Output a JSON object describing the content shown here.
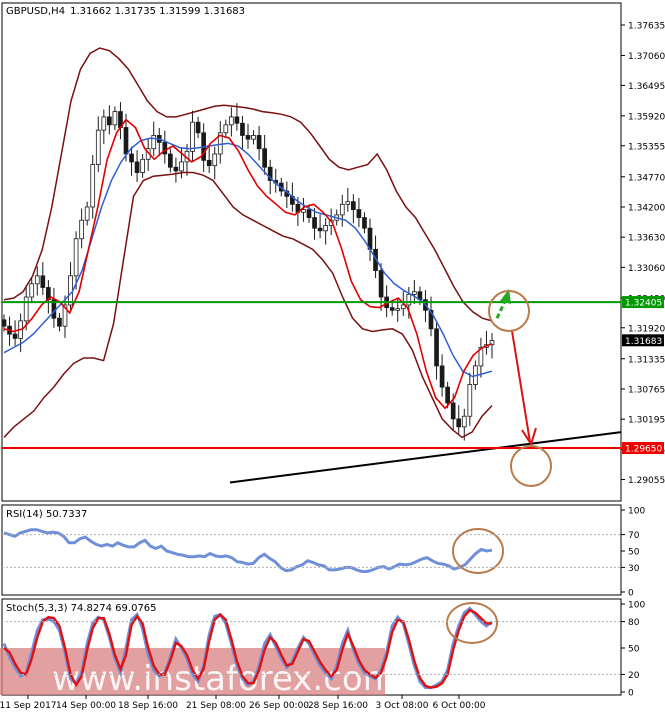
{
  "header": {
    "symbol": "GBPUSD,H4",
    "ohlc": "1.31662 1.31735 1.31599 1.31683"
  },
  "watermark": {
    "text": "www.instaforex.com"
  },
  "colors": {
    "bollinger": "#7a1010",
    "ma_fast": "#e00000",
    "ma_slow": "#2f5fd0",
    "resistance": "#009900",
    "support": "#ee0000",
    "trendline": "#000000",
    "circle": "#b87b4b",
    "arrow_up": "#22aa22",
    "arrow_down": "#dd1111",
    "candle": "#1a1a1a",
    "rsi": "#6f8fd8",
    "stoch_main": "#6f8fd8",
    "stoch_signal": "#e01010",
    "watermark_bg": "#d98080"
  },
  "chart_data": [
    {
      "type": "candlestick",
      "name_label": "GBPUSD,H4",
      "ylim": [
        1.2865,
        1.3805
      ],
      "yticks": [
        "1.37635",
        "1.37060",
        "1.36495",
        "1.35920",
        "1.35355",
        "1.34770",
        "1.34200",
        "1.33630",
        "1.33060",
        "1.32480",
        "1.31920",
        "1.31335",
        "1.30765",
        "1.30195",
        "1.29625",
        "1.29055"
      ],
      "xticks": [
        "11 Sep 2017",
        "14 Sep 00:00",
        "18 Sep 16:00",
        "21 Sep 08:00",
        "26 Sep 00:00",
        "28 Sep 16:00",
        "3 Oct 08:00",
        "6 Oct 00:00"
      ],
      "levels": [
        {
          "name": "resistance",
          "value": 1.32405,
          "label": "1.32405"
        },
        {
          "name": "support",
          "value": 1.2965,
          "label": "1.29650"
        },
        {
          "name": "current",
          "value": 1.31683,
          "label": "1.31683"
        }
      ],
      "close": [
        1.3195,
        1.318,
        1.3172,
        1.3205,
        1.325,
        1.3275,
        1.329,
        1.3268,
        1.3245,
        1.321,
        1.3195,
        1.3235,
        1.329,
        1.336,
        1.3395,
        1.342,
        1.35,
        1.3565,
        1.359,
        1.3575,
        1.36,
        1.357,
        1.352,
        1.3505,
        1.3485,
        1.351,
        1.353,
        1.3555,
        1.3542,
        1.352,
        1.3495,
        1.3488,
        1.3505,
        1.3525,
        1.358,
        1.356,
        1.3508,
        1.3498,
        1.352,
        1.356,
        1.3575,
        1.359,
        1.3578,
        1.3555,
        1.3548,
        1.3555,
        1.353,
        1.3495,
        1.347,
        1.3465,
        1.345,
        1.344,
        1.3425,
        1.341,
        1.3415,
        1.34,
        1.338,
        1.3375,
        1.3385,
        1.3395,
        1.3405,
        1.3425,
        1.343,
        1.3415,
        1.34,
        1.338,
        1.334,
        1.33,
        1.325,
        1.323,
        1.3225,
        1.3228,
        1.3235,
        1.3255,
        1.326,
        1.3245,
        1.3225,
        1.319,
        1.312,
        1.308,
        1.305,
        1.302,
        1.3005,
        1.3025,
        1.3085,
        1.312,
        1.3155,
        1.316,
        1.3168
      ],
      "bb_upper": [
        1.3245,
        1.3248,
        1.326,
        1.329,
        1.334,
        1.342,
        1.352,
        1.362,
        1.368,
        1.371,
        1.372,
        1.3715,
        1.37,
        1.368,
        1.365,
        1.362,
        1.36,
        1.359,
        1.359,
        1.3595,
        1.36,
        1.3605,
        1.361,
        1.3612,
        1.361,
        1.3608,
        1.3605,
        1.36,
        1.3598,
        1.3595,
        1.359,
        1.358,
        1.356,
        1.3535,
        1.351,
        1.3495,
        1.349,
        1.3495,
        1.35,
        1.352,
        1.349,
        1.345,
        1.342,
        1.34,
        1.337,
        1.334,
        1.3305,
        1.327,
        1.324,
        1.3222,
        1.321,
        1.3205
      ],
      "bb_lower": [
        1.2985,
        1.3005,
        1.302,
        1.3035,
        1.306,
        1.308,
        1.3105,
        1.3125,
        1.3135,
        1.3135,
        1.313,
        1.32,
        1.332,
        1.344,
        1.347,
        1.3478,
        1.348,
        1.3482,
        1.3485,
        1.3485,
        1.348,
        1.347,
        1.3445,
        1.342,
        1.3405,
        1.3395,
        1.3385,
        1.3375,
        1.3365,
        1.336,
        1.335,
        1.334,
        1.332,
        1.3295,
        1.325,
        1.321,
        1.319,
        1.3185,
        1.3188,
        1.319,
        1.318,
        1.315,
        1.31,
        1.306,
        1.302,
        1.3,
        1.2985,
        1.2995,
        1.3025,
        1.3045
      ],
      "ma_slow": [
        1.3145,
        1.3155,
        1.3165,
        1.318,
        1.32,
        1.322,
        1.324,
        1.326,
        1.33,
        1.336,
        1.342,
        1.347,
        1.3505,
        1.353,
        1.3545,
        1.355,
        1.3548,
        1.354,
        1.3532,
        1.353,
        1.3532,
        1.3535,
        1.3538,
        1.354,
        1.3535,
        1.352,
        1.35,
        1.348,
        1.3462,
        1.3448,
        1.3432,
        1.342,
        1.341,
        1.3405,
        1.34,
        1.3395,
        1.338,
        1.3355,
        1.3325,
        1.3295,
        1.3275,
        1.3262,
        1.3252,
        1.324,
        1.3215,
        1.318,
        1.314,
        1.311,
        1.31,
        1.3105,
        1.311
      ],
      "ma_fast": [
        1.319,
        1.3185,
        1.319,
        1.321,
        1.3235,
        1.325,
        1.324,
        1.322,
        1.326,
        1.334,
        1.342,
        1.351,
        1.356,
        1.3585,
        1.357,
        1.353,
        1.351,
        1.3525,
        1.3535,
        1.352,
        1.3505,
        1.3515,
        1.354,
        1.3555,
        1.355,
        1.3525,
        1.349,
        1.346,
        1.344,
        1.3425,
        1.341,
        1.3405,
        1.342,
        1.3425,
        1.341,
        1.339,
        1.334,
        1.328,
        1.3245,
        1.3232,
        1.323,
        1.324,
        1.3248,
        1.323,
        1.318,
        1.311,
        1.306,
        1.304,
        1.306,
        1.311,
        1.314,
        1.3155,
        1.3162
      ],
      "annotations": [
        {
          "name": "up-arrow",
          "from": 1.3225,
          "to": 1.3235
        },
        {
          "name": "down-arrow",
          "from": 1.3235,
          "to": 1.2965
        },
        {
          "name": "trendline",
          "from": 1.29,
          "to": 1.2995
        }
      ]
    },
    {
      "type": "line",
      "name_label": "RSI(14) 50.7337",
      "ylim": [
        0,
        100
      ],
      "yticks": [
        "100",
        "70",
        "50",
        "30",
        "0"
      ],
      "values": [
        72,
        70,
        68,
        72,
        74,
        76,
        76,
        74,
        72,
        73,
        72,
        68,
        60,
        60,
        65,
        67,
        62,
        58,
        56,
        58,
        56,
        60,
        57,
        55,
        55,
        60,
        63,
        56,
        53,
        56,
        50,
        48,
        46,
        45,
        43,
        43,
        44,
        43,
        47,
        44,
        43,
        44,
        42,
        37,
        36,
        34,
        35,
        42,
        46,
        41,
        37,
        30,
        26,
        27,
        31,
        33,
        38,
        36,
        33,
        32,
        27,
        27,
        28,
        30,
        30,
        27,
        25,
        25,
        27,
        30,
        31,
        28,
        31,
        34,
        33,
        34,
        37,
        40,
        42,
        38,
        35,
        34,
        32,
        28,
        30,
        33,
        40,
        47,
        52,
        50,
        51
      ],
      "threshold_lines": [
        70,
        30
      ]
    },
    {
      "type": "line",
      "name_label": "Stoch(5,3,3) 74.8274 69.0765",
      "ylim": [
        0,
        100
      ],
      "yticks": [
        "100",
        "80",
        "50",
        "20",
        "0"
      ],
      "series": [
        {
          "name": "%K",
          "values": [
            55,
            40,
            28,
            18,
            22,
            45,
            70,
            82,
            83,
            80,
            70,
            45,
            15,
            10,
            22,
            55,
            78,
            85,
            82,
            62,
            38,
            22,
            50,
            82,
            88,
            72,
            42,
            25,
            18,
            22,
            40,
            60,
            50,
            38,
            20,
            12,
            30,
            65,
            86,
            88,
            78,
            55,
            30,
            15,
            8,
            12,
            30,
            55,
            65,
            52,
            38,
            28,
            35,
            50,
            62,
            55,
            42,
            30,
            22,
            15,
            30,
            55,
            70,
            48,
            32,
            22,
            18,
            15,
            25,
            45,
            75,
            85,
            78,
            55,
            30,
            12,
            5,
            5,
            8,
            12,
            25,
            55,
            75,
            90,
            95,
            88,
            80,
            75,
            80
          ]
        },
        {
          "name": "%D",
          "values": [
            50,
            45,
            32,
            22,
            20,
            38,
            62,
            80,
            85,
            84,
            75,
            50,
            20,
            8,
            18,
            48,
            72,
            84,
            84,
            66,
            42,
            26,
            42,
            76,
            86,
            78,
            50,
            30,
            20,
            20,
            36,
            56,
            52,
            42,
            25,
            15,
            26,
            58,
            82,
            88,
            82,
            60,
            35,
            18,
            10,
            10,
            25,
            48,
            62,
            56,
            42,
            30,
            32,
            46,
            60,
            58,
            46,
            34,
            25,
            18,
            25,
            48,
            66,
            52,
            36,
            25,
            20,
            16,
            22,
            40,
            68,
            82,
            80,
            60,
            35,
            16,
            7,
            5,
            6,
            10,
            20,
            48,
            70,
            86,
            93,
            90,
            84,
            78,
            78
          ]
        }
      ],
      "threshold_lines": [
        80,
        20
      ]
    }
  ]
}
